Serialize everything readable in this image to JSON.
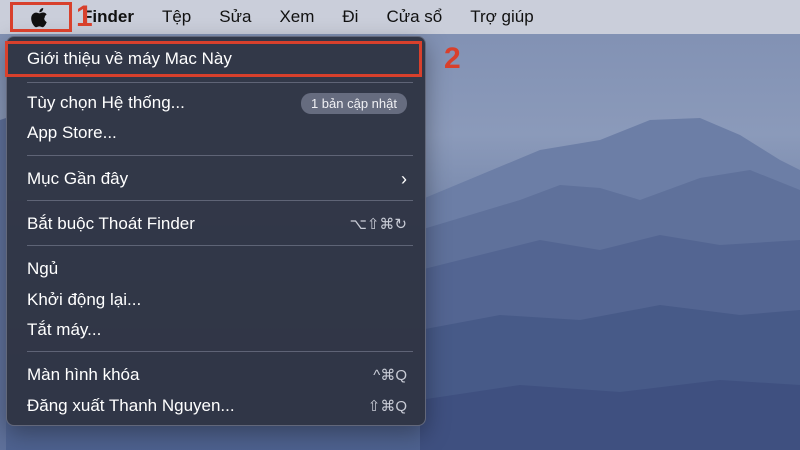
{
  "menubar": {
    "apple_icon": "apple-logo-icon",
    "items": [
      "Finder",
      "Tệp",
      "Sửa",
      "Xem",
      "Đi",
      "Cửa sổ",
      "Trợ giúp"
    ]
  },
  "annotations": {
    "step1": "1",
    "step2": "2",
    "color": "#d8402c"
  },
  "apple_menu": {
    "about": "Giới thiệu về máy Mac Này",
    "system_prefs": "Tùy chọn Hệ thống...",
    "update_badge": "1 bản cập nhật",
    "app_store": "App Store...",
    "recent_items": "Mục Gần đây",
    "recent_chevron": "›",
    "force_quit": "Bắt buộc Thoát Finder",
    "force_quit_shortcut": "⌥⇧⌘↻",
    "sleep": "Ngủ",
    "restart": "Khởi động lại...",
    "shutdown": "Tắt máy...",
    "lock_screen": "Màn hình khóa",
    "lock_screen_shortcut": "^⌘Q",
    "log_out": "Đăng xuất Thanh Nguyen...",
    "log_out_shortcut": "⇧⌘Q"
  }
}
